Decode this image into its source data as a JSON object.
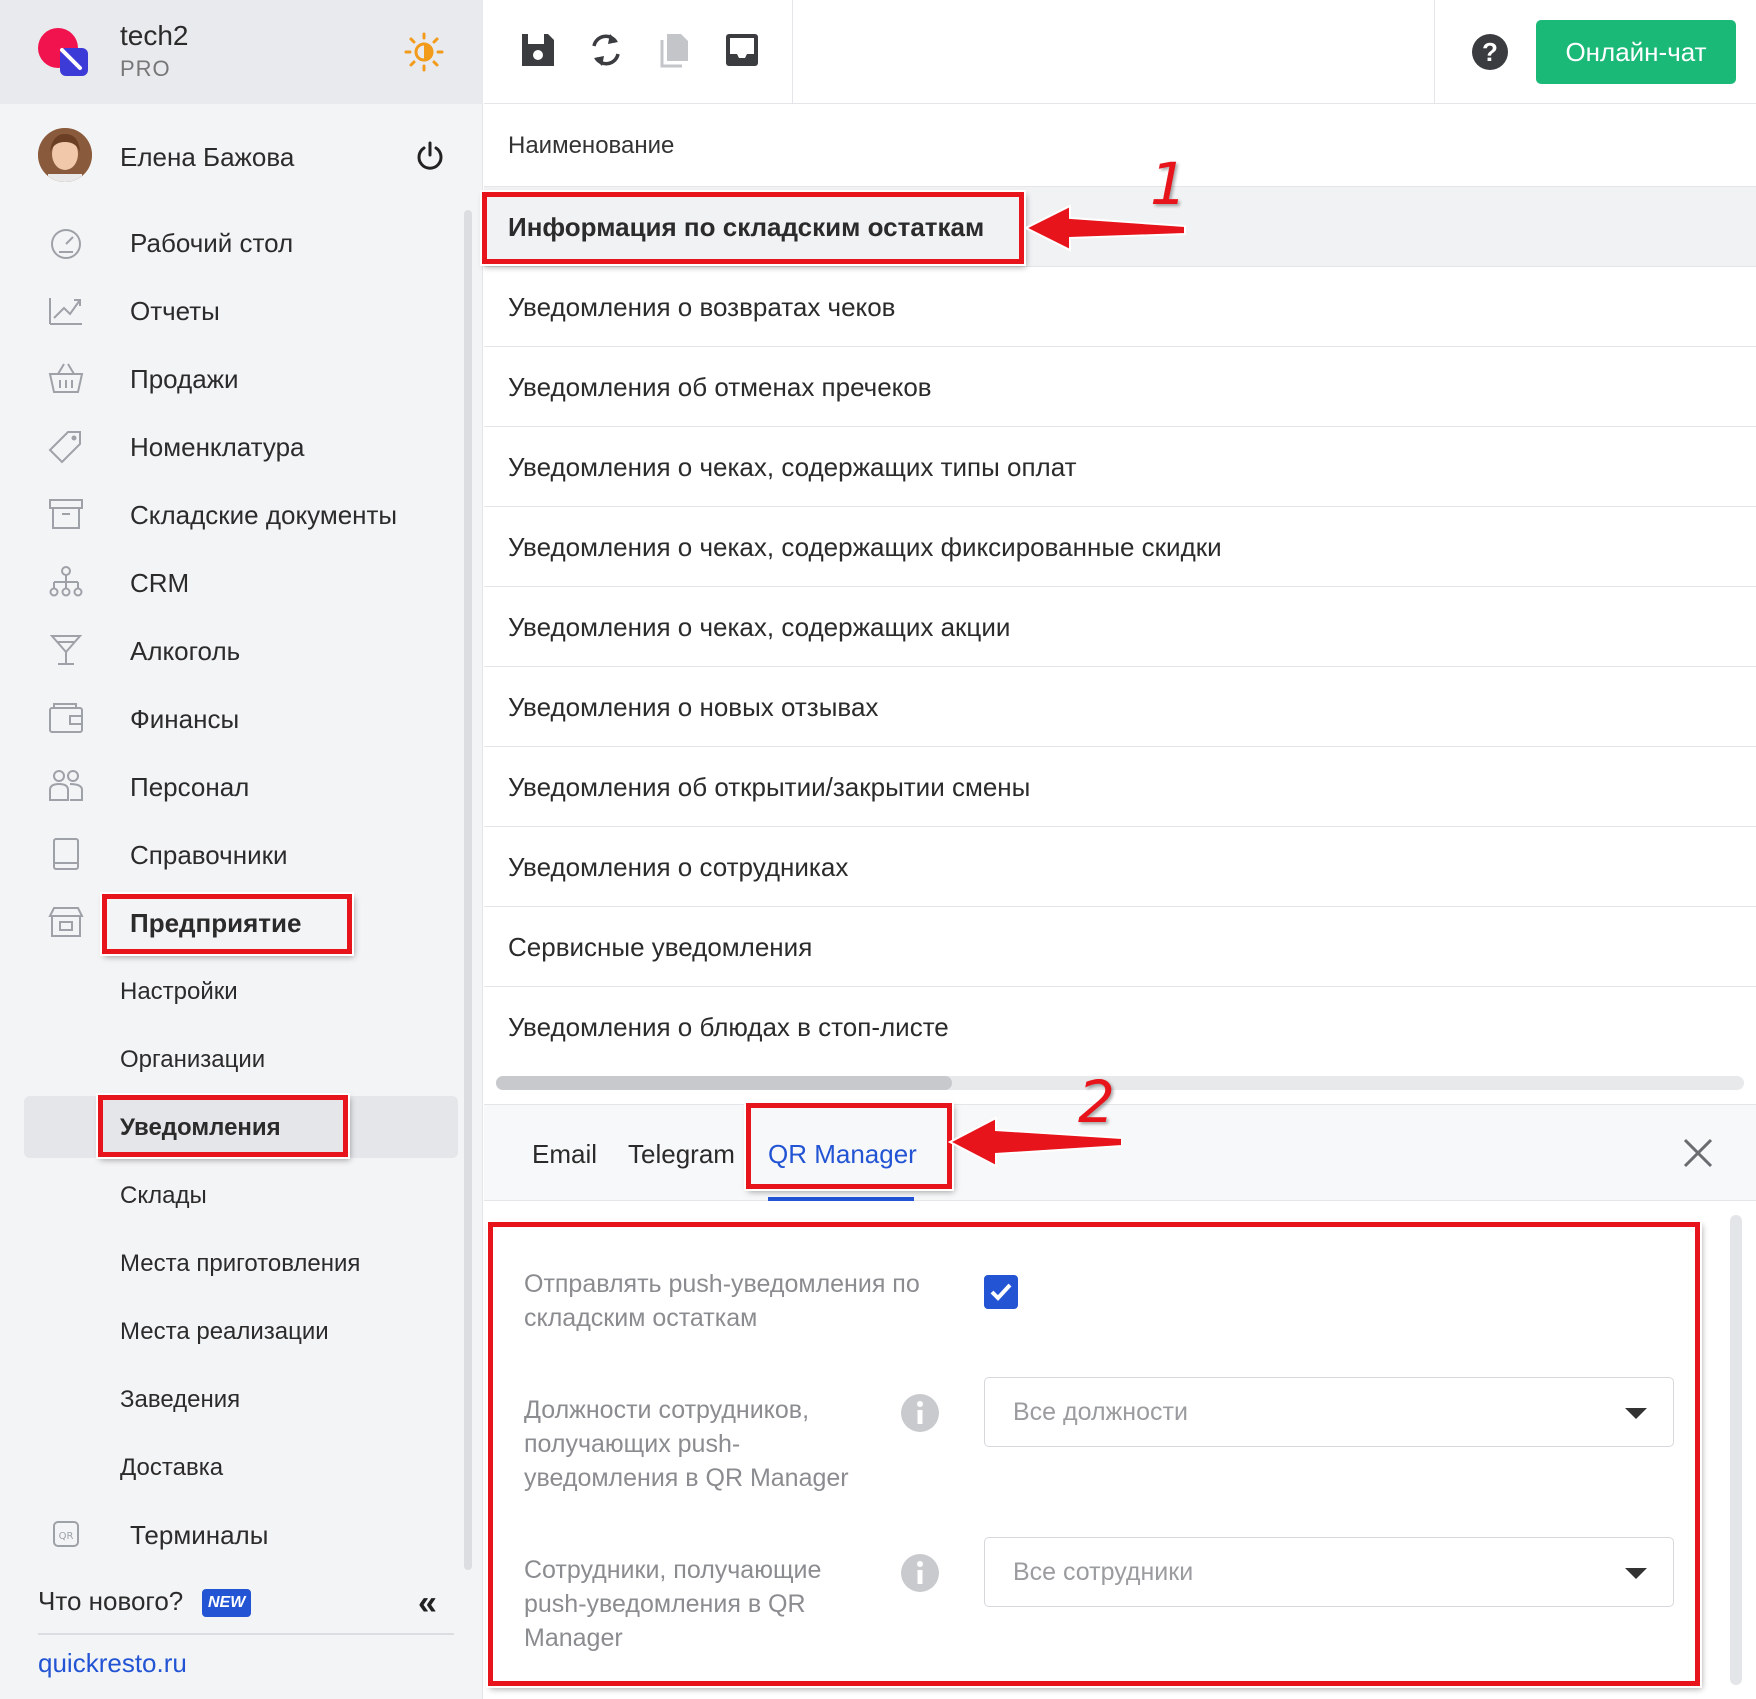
{
  "brand": {
    "name": "tech2",
    "plan": "PRO"
  },
  "user": {
    "name": "Елена Бажова"
  },
  "sidebar": {
    "items": [
      {
        "label": "Рабочий стол",
        "icon": "dashboard-icon"
      },
      {
        "label": "Отчеты",
        "icon": "chart-up-icon"
      },
      {
        "label": "Продажи",
        "icon": "basket-icon"
      },
      {
        "label": "Номенклатура",
        "icon": "tag-icon"
      },
      {
        "label": "Складские документы",
        "icon": "archive-icon"
      },
      {
        "label": "CRM",
        "icon": "hierarchy-icon"
      },
      {
        "label": "Алкоголь",
        "icon": "cocktail-icon"
      },
      {
        "label": "Финансы",
        "icon": "wallet-icon"
      },
      {
        "label": "Персонал",
        "icon": "people-icon"
      },
      {
        "label": "Справочники",
        "icon": "book-icon"
      },
      {
        "label": "Предприятие",
        "icon": "store-icon"
      }
    ],
    "sub_items": [
      "Настройки",
      "Организации",
      "Уведомления",
      "Склады",
      "Места приготовления",
      "Места реализации",
      "Заведения",
      "Доставка"
    ],
    "terminals": {
      "label": "Терминалы",
      "icon": "qr-icon"
    },
    "whats_new": "Что нового?",
    "new_badge": "NEW",
    "collapse": "«",
    "site_link": "quickresto.ru"
  },
  "toolbar": {
    "chat_button": "Онлайн-чат"
  },
  "table": {
    "header": "Наименование",
    "rows": [
      "Информация по складским остаткам",
      "Уведомления о возвратах чеков",
      "Уведомления об отменах пречеков",
      "Уведомления о чеках, содержащих типы оплат",
      "Уведомления о чеках, содержащих фиксированные скидки",
      "Уведомления о чеках, содержащих акции",
      "Уведомления о новых отзывах",
      "Уведомления об открытии/закрытии смены",
      "Уведомления о сотрудниках",
      "Сервисные уведомления",
      "Уведомления о блюдах в стоп-листе"
    ]
  },
  "panel": {
    "tabs": [
      "Email",
      "Telegram",
      "QR Manager"
    ],
    "active_tab": "QR Manager",
    "push_label_1": "Отправлять push-уведомления по",
    "push_label_2": "складским остаткам",
    "positions_label_1": "Должности сотрудников,",
    "positions_label_2": "получающих push-",
    "positions_label_3": "уведомления в QR Manager",
    "positions_value": "Все должности",
    "employees_label_1": "Сотрудники, получающие",
    "employees_label_2": "push-уведомления в QR",
    "employees_label_3": "Manager",
    "employees_value": "Все сотрудники"
  },
  "annotations": {
    "n1": "1",
    "n2": "2"
  },
  "colors": {
    "accent": "#2254d4",
    "chat_green": "#1bb978",
    "annotation_red": "#e8141c"
  }
}
